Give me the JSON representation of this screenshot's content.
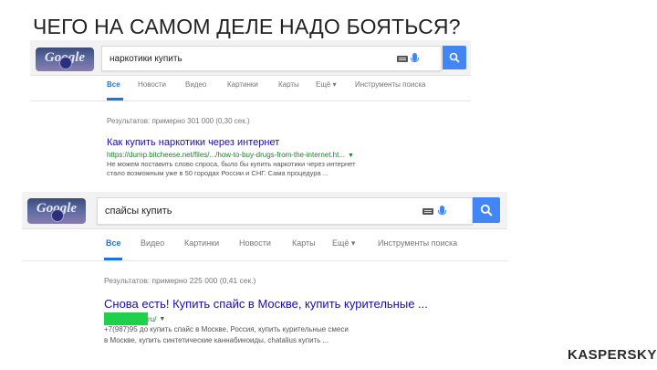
{
  "slide": {
    "title": "ЧЕГО НА САМОМ ДЕЛЕ НАДО БОЯТЬСЯ?",
    "footer_logo": "KASPERSKY"
  },
  "search1": {
    "logo_text": "Google",
    "query": "наркотики купить",
    "tabs": [
      "Все",
      "Новости",
      "Видео",
      "Картинки",
      "Карты",
      "Ещё ▾",
      "Инструменты поиска"
    ],
    "active_tab": "Все",
    "stats": "Результатов: примерно 301 000 (0,30 сек.)",
    "result": {
      "title": "Как купить наркотики через интернет",
      "url": "https://dump.bitcheese.net/files/.../how-to-buy-drugs-from-the-internet.ht...",
      "snippet": [
        "Не можем поставить слово спроса, было бы купить наркотики через интернет",
        "стало возможным уже в 50 городах России и СНГ. Сама процедура ..."
      ]
    }
  },
  "search2": {
    "logo_text": "Google",
    "query": "спайсы купить",
    "tabs": [
      "Все",
      "Видео",
      "Картинки",
      "Новости",
      "Карты",
      "Ещё ▾",
      "Инструменты поиска"
    ],
    "active_tab": "Все",
    "stats": "Результатов: примерно 225 000 (0,41 сек.)",
    "result": {
      "title": "Снова есть! Купить спайс в Москве, купить курительные ...",
      "url_suffix": "ru/",
      "snippet": [
        "+7(987)95           до купить спайс в Москве, Россия, купить курительные смеси",
        "в Москве, купить синтетические каннабиноиды, chatalius купить ..."
      ]
    }
  },
  "colors": {
    "link": "#1a0dab",
    "url_green": "#1a7f2b",
    "google_blue": "#4285f4",
    "redaction_green": "#1fd04a",
    "kaspersky_green": "#119e7b"
  }
}
